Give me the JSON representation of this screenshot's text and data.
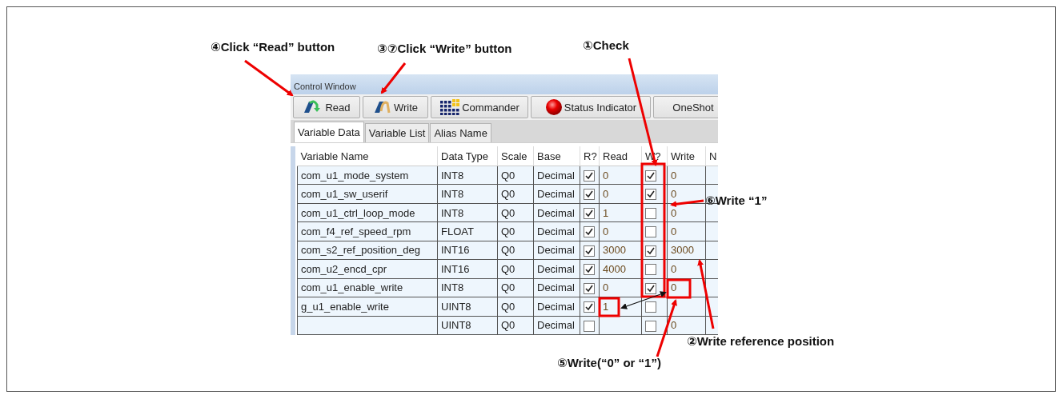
{
  "annotations": [
    {
      "text": "④Click “Read” button"
    },
    {
      "text": "③⑦Click “Write” button"
    },
    {
      "text": "①Check"
    },
    {
      "text": "⑥Write “1”"
    },
    {
      "text": "②Write reference position"
    },
    {
      "text": "⑤Write(“0” or “1”)"
    }
  ],
  "window": {
    "title": "Control Window"
  },
  "toolbar": [
    {
      "kind": "read",
      "label": "Read"
    },
    {
      "kind": "write",
      "label": "Write"
    },
    {
      "kind": "commander",
      "label": "Commander"
    },
    {
      "kind": "status",
      "label": "Status Indicator"
    },
    {
      "kind": "plain",
      "label": "OneShot"
    }
  ],
  "tabs": [
    {
      "label": "Variable Data",
      "selected": true
    },
    {
      "label": "Variable List",
      "selected": false
    },
    {
      "label": "Alias Name",
      "selected": false
    }
  ],
  "table": {
    "columns": [
      "Variable Name",
      "Data Type",
      "Scale",
      "Base",
      "R?",
      "Read",
      "W?",
      "Write",
      "N"
    ],
    "rows": [
      {
        "name": "com_u1_mode_system",
        "type": "INT8",
        "scale": "Q0",
        "base": "Decimal",
        "r_checked": true,
        "read": "0",
        "w_checked": true,
        "write": "0"
      },
      {
        "name": "com_u1_sw_userif",
        "type": "INT8",
        "scale": "Q0",
        "base": "Decimal",
        "r_checked": true,
        "read": "0",
        "w_checked": true,
        "write": "0"
      },
      {
        "name": "com_u1_ctrl_loop_mode",
        "type": "INT8",
        "scale": "Q0",
        "base": "Decimal",
        "r_checked": true,
        "read": "1",
        "w_checked": false,
        "write": "0"
      },
      {
        "name": "com_f4_ref_speed_rpm",
        "type": "FLOAT",
        "scale": "Q0",
        "base": "Decimal",
        "r_checked": true,
        "read": "0",
        "w_checked": false,
        "write": "0"
      },
      {
        "name": "com_s2_ref_position_deg",
        "type": "INT16",
        "scale": "Q0",
        "base": "Decimal",
        "r_checked": true,
        "read": "3000",
        "w_checked": true,
        "write": "3000"
      },
      {
        "name": "com_u2_encd_cpr",
        "type": "INT16",
        "scale": "Q0",
        "base": "Decimal",
        "r_checked": true,
        "read": "4000",
        "w_checked": false,
        "write": "0"
      },
      {
        "name": "com_u1_enable_write",
        "type": "INT8",
        "scale": "Q0",
        "base": "Decimal",
        "r_checked": true,
        "read": "0",
        "w_checked": true,
        "write": "0"
      },
      {
        "name": "g_u1_enable_write",
        "type": "UINT8",
        "scale": "Q0",
        "base": "Decimal",
        "r_checked": true,
        "read": "1",
        "w_checked": false
      },
      {
        "type": "UINT8",
        "scale": "Q0",
        "base": "Decimal",
        "r_checked": false,
        "w_checked": false,
        "write": "0"
      }
    ]
  }
}
